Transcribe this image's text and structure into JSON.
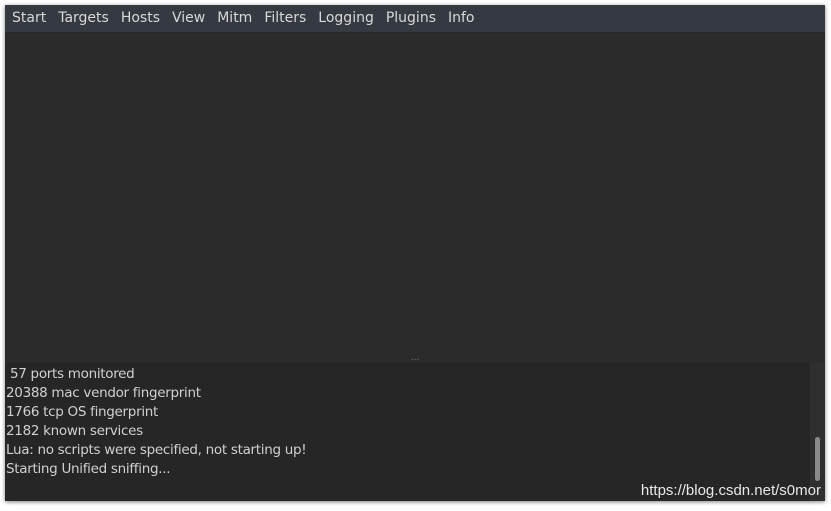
{
  "menu": [
    "Start",
    "Targets",
    "Hosts",
    "View",
    "Mitm",
    "Filters",
    "Logging",
    "Plugins",
    "Info"
  ],
  "splitter_glyph": "...",
  "log": [
    " 57 ports monitored",
    "20388 mac vendor fingerprint",
    "1766 tcp OS fingerprint",
    "2182 known services",
    "Lua: no scripts were specified, not starting up!",
    "Starting Unified sniffing..."
  ],
  "scroll_position": 1.0,
  "watermark": "https://blog.csdn.net/s0mor"
}
